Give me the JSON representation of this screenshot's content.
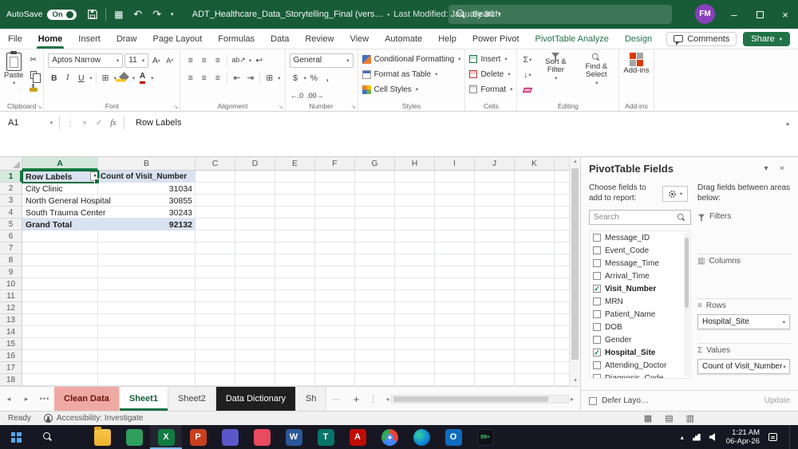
{
  "colors": {
    "titlebar": "#185C37",
    "accent": "#107C41",
    "contextual_tab": "#217346",
    "selection_fill": "#D9E2F1",
    "tab_red": "#EFA9A4",
    "tab_dark": "#1F1F1F",
    "taskbar": "#161722"
  },
  "icons": {
    "caret_down": "▾",
    "caret_up": "▴",
    "caret_left": "◂",
    "caret_right": "▸",
    "undo": "↶",
    "redo": "↷",
    "more_h": "•••",
    "ellipsis": "⋯",
    "kebab": "⋮",
    "close": "×",
    "minimize": "–",
    "check": "✓",
    "cancel": "×",
    "fx": "fx",
    "sigma": "Σ",
    "scissors": "✂",
    "lines": "≡",
    "grid": "⊞",
    "qa": "▦",
    "dollar": "$",
    "percent": "%",
    "comma": ",",
    "inc_dec": "←.0",
    "dec_dec": ".00→",
    "orient": "ab↗",
    "wrap": "↩",
    "indent_l": "⇤",
    "indent_r": "⇥",
    "dialog": "↘",
    "plus": "+",
    "fill_down": "↓",
    "view_normal": "▦",
    "view_layout": "▤",
    "view_break": "▥",
    "bold": "B",
    "italic": "I",
    "underline": "U",
    "font_a": "A",
    "columns_area": "▥",
    "rows_area": "≡",
    "tray_chevron": "▴"
  },
  "titlebar": {
    "autosave_label": "AutoSave",
    "autosave_state": "On",
    "title": "ADT_Healthcare_Data_Storytelling_Final (vers…",
    "bullet": "•",
    "modified": "Last Modified: January 30",
    "search_placeholder": "Search",
    "avatar_initials": "FM"
  },
  "ribbon": {
    "tabs": [
      {
        "label": "File"
      },
      {
        "label": "Home",
        "active": true
      },
      {
        "label": "Insert"
      },
      {
        "label": "Draw"
      },
      {
        "label": "Page Layout"
      },
      {
        "label": "Formulas"
      },
      {
        "label": "Data"
      },
      {
        "label": "Review"
      },
      {
        "label": "View"
      },
      {
        "label": "Automate"
      },
      {
        "label": "Help"
      },
      {
        "label": "Power Pivot"
      },
      {
        "label": "PivotTable Analyze",
        "contextual": true
      },
      {
        "label": "Design",
        "contextual": true
      }
    ],
    "comments_label": "Comments",
    "share_label": "Share",
    "clipboard": {
      "label": "Clipboard",
      "paste_label": "Paste"
    },
    "font": {
      "label": "Font",
      "name": "Aptos Narrow",
      "size": "11"
    },
    "alignment": {
      "label": "Alignment"
    },
    "number": {
      "label": "Number",
      "format": "General"
    },
    "styles": {
      "label": "Styles",
      "conditional": "Conditional Formatting",
      "table": "Format as Table",
      "cell": "Cell Styles"
    },
    "cells": {
      "label": "Cells",
      "insert": "Insert",
      "delete": "Delete",
      "format": "Format"
    },
    "editing": {
      "label": "Editing",
      "sort": "Sort & Filter",
      "find": "Find & Select"
    },
    "addins": {
      "label": "Add-ins"
    }
  },
  "formula_bar": {
    "name_box": "A1",
    "content": "Row Labels"
  },
  "grid": {
    "columns": [
      "A",
      "B",
      "C",
      "D",
      "E",
      "F",
      "G",
      "H",
      "I",
      "J",
      "K"
    ],
    "row_numbers": [
      "1",
      "2",
      "3",
      "4",
      "5",
      "6",
      "7",
      "8",
      "9",
      "10",
      "11",
      "12",
      "13",
      "14",
      "15",
      "16",
      "17",
      "18"
    ],
    "pivot": {
      "header": {
        "row_label": "Row Labels",
        "value_label": "Count of Visit_Number"
      },
      "rows": [
        {
          "label": "City Clinic",
          "value": "31034"
        },
        {
          "label": "North General Hospital",
          "value": "30855"
        },
        {
          "label": "South Trauma Center",
          "value": "30243"
        }
      ],
      "total": {
        "label": "Grand Total",
        "value": "92132"
      }
    }
  },
  "pane": {
    "title": "PivotTable Fields",
    "choose_text": "Choose fields to add to report:",
    "drag_text": "Drag fields between areas below:",
    "search_placeholder": "Search",
    "fields": [
      {
        "label": "Message_ID",
        "checked": false
      },
      {
        "label": "Event_Code",
        "checked": false
      },
      {
        "label": "Message_Time",
        "checked": false
      },
      {
        "label": "Arrival_Time",
        "checked": false
      },
      {
        "label": "Visit_Number",
        "checked": true
      },
      {
        "label": "MRN",
        "checked": false
      },
      {
        "label": "Patient_Name",
        "checked": false
      },
      {
        "label": "DOB",
        "checked": false
      },
      {
        "label": "Gender",
        "checked": false
      },
      {
        "label": "Hospital_Site",
        "checked": true
      },
      {
        "label": "Attending_Doctor",
        "checked": false
      },
      {
        "label": "Diagnosis_Code",
        "checked": false
      }
    ],
    "areas": {
      "filters_label": "Filters",
      "columns_label": "Columns",
      "rows_label": "Rows",
      "values_label": "Values",
      "rows_chip": "Hospital_Site",
      "values_chip": "Count of Visit_Number"
    },
    "defer_label": "Defer Layo…",
    "update_label": "Update"
  },
  "sheet_bar": {
    "tabs": [
      {
        "label": "Clean Data",
        "style": "red"
      },
      {
        "label": "Sheet1",
        "style": "active"
      },
      {
        "label": "Sheet2",
        "style": "normal"
      },
      {
        "label": "Data Dictionary",
        "style": "dark"
      },
      {
        "label": "Sh",
        "style": "normal"
      }
    ]
  },
  "status_bar": {
    "mode": "Ready",
    "accessibility": "Accessibility: Investigate"
  },
  "taskbar": {
    "clock_time": "1:21 AM",
    "clock_date": "06-Apr-26",
    "badge": "99+",
    "glyphs": {
      "excel": "X",
      "word": "W",
      "powerpoint": "P",
      "teams": "T",
      "acrobat": "A",
      "outlook": "O"
    }
  }
}
